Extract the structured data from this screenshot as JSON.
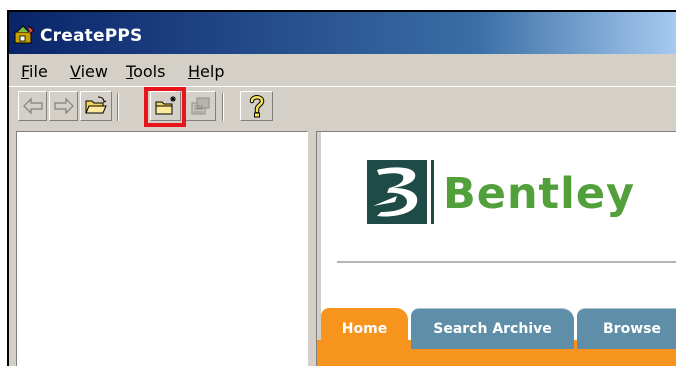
{
  "window": {
    "title": "CreatePPS"
  },
  "menu": {
    "items": [
      {
        "label": "File"
      },
      {
        "label": "View"
      },
      {
        "label": "Tools"
      },
      {
        "label": "Help"
      }
    ]
  },
  "toolbar": {
    "buttons": [
      {
        "icon": "back-arrow-icon",
        "enabled": false
      },
      {
        "icon": "forward-arrow-icon",
        "enabled": false
      },
      {
        "icon": "open-folder-icon",
        "enabled": true
      },
      {
        "icon": "new-project-icon",
        "enabled": true,
        "highlighted": true
      },
      {
        "icon": "build-icon",
        "enabled": false
      },
      {
        "icon": "help-icon",
        "enabled": true
      }
    ],
    "highlight_color": "#e8141b"
  },
  "browser": {
    "logo_text": "Bentley",
    "logo_reg": "®",
    "brand_color": "#52a03b",
    "tabs": [
      {
        "label": "Home",
        "active": true
      },
      {
        "label": "Search Archive",
        "active": false
      },
      {
        "label": "Browse",
        "active": false
      }
    ],
    "tab_active_color": "#f7941d",
    "tab_inactive_color": "#5f8fa8"
  }
}
